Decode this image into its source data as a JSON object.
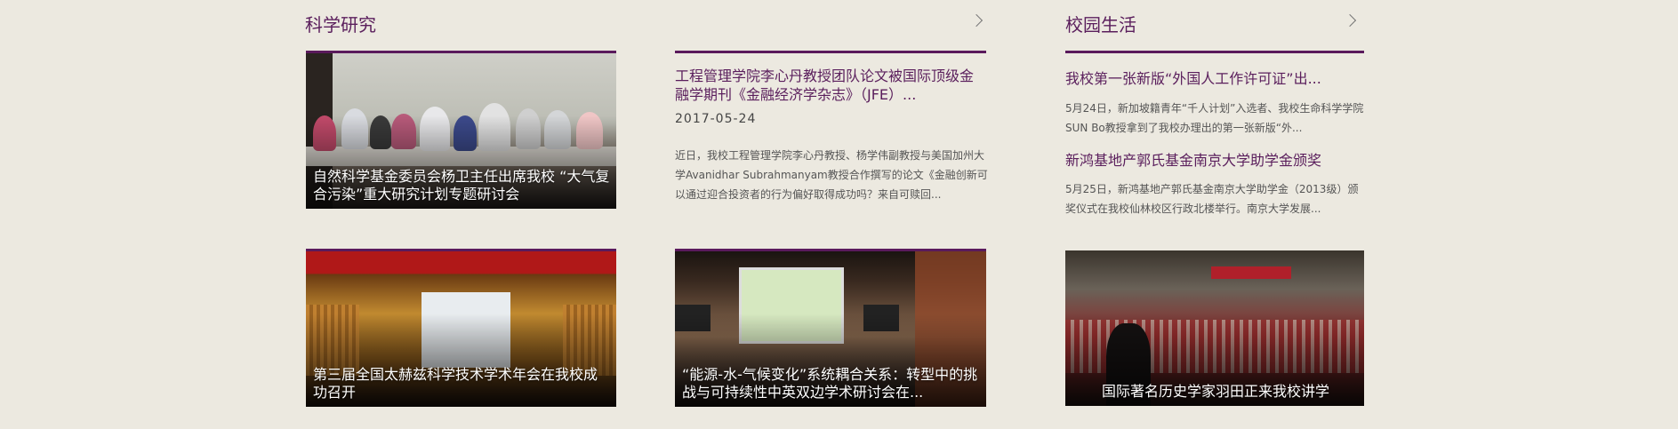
{
  "sections": {
    "research": {
      "title": "科学研究"
    },
    "campus": {
      "title": "校园生活"
    }
  },
  "research": {
    "photo_card_1": {
      "caption": "自然科学基金委员会杨卫主任出席我校 “大气复合污染”重大研究计划专题研讨会"
    },
    "featured_news": {
      "title": "工程管理学院李心丹教授团队论文被国际顶级金融学期刊《金融经济学杂志》（JFE）...",
      "date": "2017-05-24",
      "summary": "近日，我校工程管理学院李心丹教授、杨学伟副教授与美国加州大学Avanidhar Subrahmanyam教授合作撰写的论文《金融创新可以通过迎合投资者的行为偏好取得成功吗？来自可赎回..."
    },
    "photo_card_2": {
      "caption": "第三届全国太赫兹科学技术学术年会在我校成功召开"
    },
    "photo_card_3": {
      "caption": "“能源-水-气候变化”系统耦合关系：转型中的挑战与可持续性中英双边学术研讨会在..."
    }
  },
  "campus": {
    "news": [
      {
        "title": "我校第一张新版“外国人工作许可证”出...",
        "summary": "5月24日，新加坡籍青年“千人计划”入选者、我校生命科学学院SUN Bo教授拿到了我校办理出的第一张新版“外..."
      },
      {
        "title": "新鸿基地产郭氏基金南京大学助学金颁奖",
        "summary": "5月25日，新鸿基地产郭氏基金南京大学助学金（2013级）颁奖仪式在我校仙林校区行政北楼举行。南京大学发展..."
      }
    ],
    "photo_card": {
      "caption": "国际著名历史学家羽田正来我校讲学"
    }
  },
  "icons": {
    "more": "chevron-right-icon"
  },
  "colors": {
    "accent": "#5a1a5c",
    "background": "#ece9e0"
  }
}
